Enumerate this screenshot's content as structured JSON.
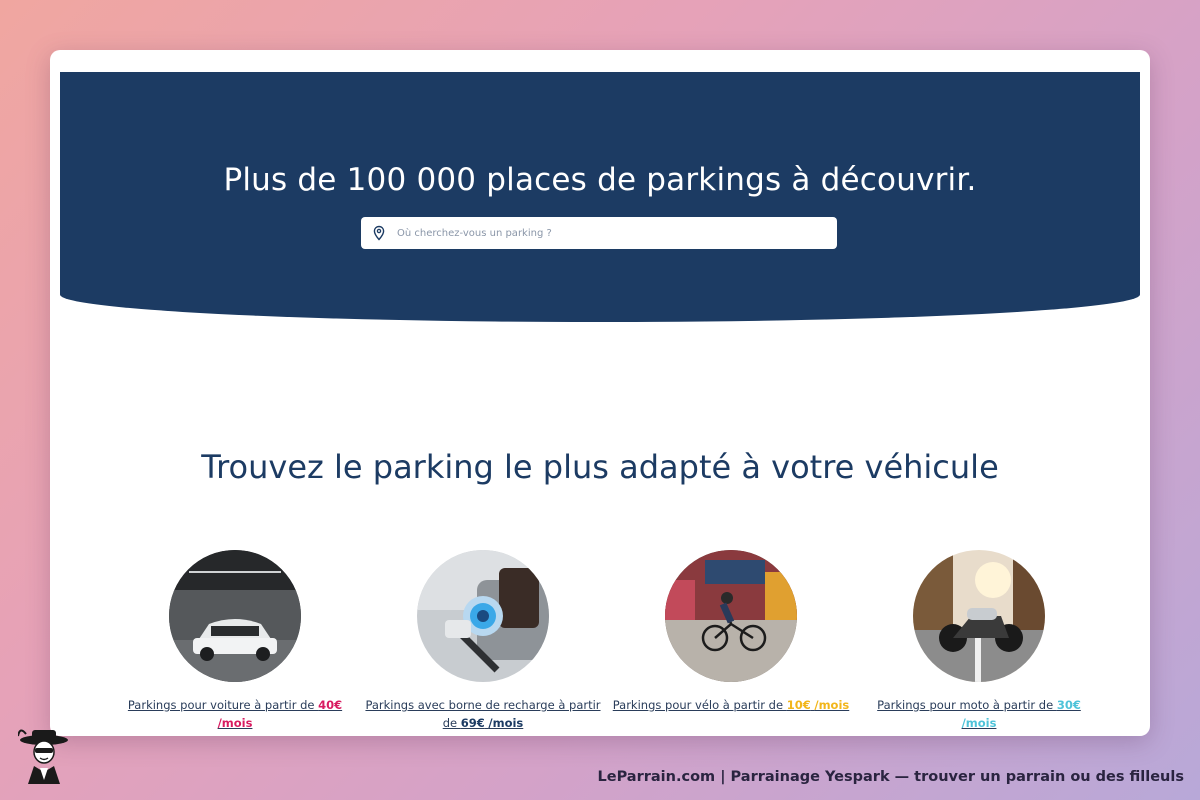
{
  "hero": {
    "title": "Plus de 100 000 places de parkings à découvrir.",
    "search_placeholder": "Où cherchez-vous un parking ?"
  },
  "section": {
    "title": "Trouvez le parking le plus adapté à votre véhicule"
  },
  "vehicles": [
    {
      "text": "Parkings pour voiture à partir de ",
      "price": "40€",
      "unit": "/mois",
      "price_color": "#d81b60",
      "image": "car-in-garage"
    },
    {
      "text": "Parkings avec borne de recharge à partir de ",
      "price": "69€",
      "unit": "/mois",
      "price_color": "#1c3b63",
      "image": "ev-charger"
    },
    {
      "text": "Parkings pour vélo à partir de ",
      "price": "10€",
      "unit": "/mois",
      "price_color": "#f2b61a",
      "image": "cyclist"
    },
    {
      "text": "Parkings pour moto à partir de ",
      "price": "30€",
      "unit": "/mois",
      "price_color": "#4fc3d9",
      "image": "motorcycle"
    }
  ],
  "footer": {
    "text": "LeParrain.com | Parrainage Yespark — trouver un parrain ou des filleuls"
  },
  "colors": {
    "hero_bg": "#1c3b63",
    "accent_pink": "#d81b60",
    "accent_yellow": "#f2b61a",
    "accent_cyan": "#4fc3d9"
  }
}
